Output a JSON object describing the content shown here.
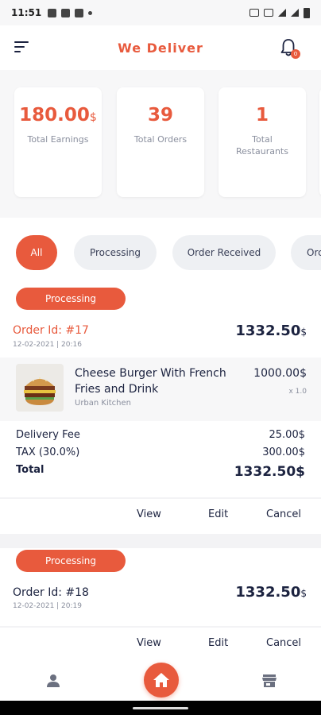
{
  "statusbar": {
    "time": "11:51"
  },
  "app": {
    "title": "We Deliver",
    "notification_count": "0",
    "accent": "#e85a3d",
    "dark": "#1c2340"
  },
  "stats": [
    {
      "value": "180.00",
      "unit": "$",
      "label": "Total Earnings"
    },
    {
      "value": "39",
      "label": "Total Orders"
    },
    {
      "value": "1",
      "label": "Total Restaurants"
    }
  ],
  "filters": [
    "All",
    "Processing",
    "Order Received",
    "Orc"
  ],
  "orders": [
    {
      "status": "Processing",
      "order_id": "Order Id: #17",
      "date": "12-02-2021 | 20:16",
      "total": "1332.50",
      "currency": "$",
      "item": {
        "name": "Cheese Burger With French Fries and Drink",
        "shop": "Urban Kitchen",
        "price": "1000.00",
        "qty": "x 1.0"
      },
      "fees": [
        {
          "label": "Delivery Fee",
          "value": "25.00"
        },
        {
          "label": "TAX (30.0%)",
          "value": "300.00"
        },
        {
          "label": "Total",
          "value": "1332.50"
        }
      ],
      "actions": [
        "View",
        "Edit",
        "Cancel"
      ]
    },
    {
      "status": "Processing",
      "order_id": "Order Id: #18",
      "date": "12-02-2021 | 20:19",
      "total": "1332.50",
      "currency": "$",
      "actions": [
        "View",
        "Edit",
        "Cancel"
      ]
    }
  ],
  "bottomnav": {
    "icons": [
      "person-icon",
      "home-icon",
      "store-icon"
    ]
  }
}
